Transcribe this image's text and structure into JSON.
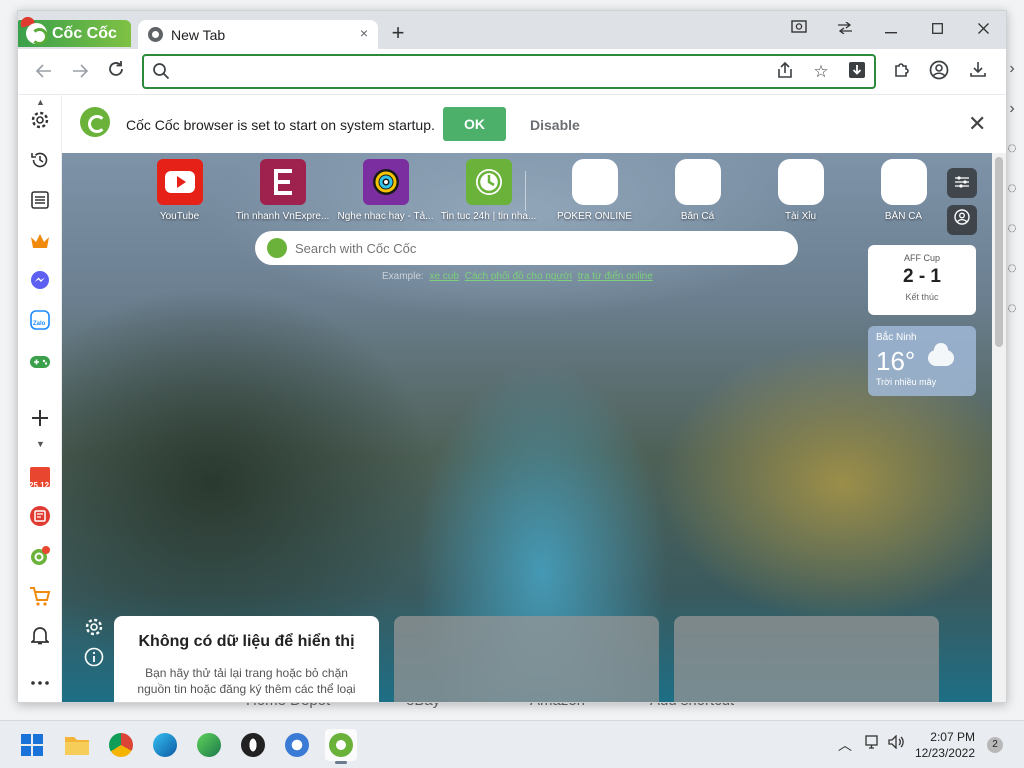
{
  "window": {
    "brand_name": "Cốc Cốc",
    "tab_title": "New Tab",
    "new_tab_symbol": "+",
    "tab_close_symbol": "×"
  },
  "omnibox": {
    "value": "",
    "placeholder": ""
  },
  "notification": {
    "message": "Cốc Cốc browser is set to start on system startup.",
    "ok_label": "OK",
    "disable_label": "Disable",
    "close_symbol": "✕"
  },
  "sidebar": {
    "items": [
      "settings-icon",
      "history-icon",
      "reading-list-icon",
      "crown-icon",
      "messenger-icon",
      "zalo-icon",
      "games-icon",
      "add-icon",
      "calendar-icon",
      "news-icon",
      "coccoc-icon",
      "shopping-icon",
      "bell-icon",
      "more-icon"
    ],
    "calendar_label": "25.12",
    "zalo_label": "Zalo"
  },
  "shortcuts": [
    {
      "label": "YouTube",
      "icon": "youtube-icon",
      "color": "#e62117"
    },
    {
      "label": "Tin nhanh VnExpre...",
      "icon": "vnexpress-icon",
      "color": "#9f224e"
    },
    {
      "label": "Nghe nhac hay - Tả...",
      "icon": "music-icon",
      "color": "#7b2ea0"
    },
    {
      "label": "Tin tuc 24h | tin nha...",
      "icon": "news24-icon",
      "color": "#6ab23a"
    },
    {
      "label": "POKER ONLINE",
      "icon": "broken-image-icon",
      "color": "#ffffff"
    },
    {
      "label": "Bắn Cá",
      "icon": "broken-image-icon",
      "color": "#ffffff"
    },
    {
      "label": "Tài Xỉu",
      "icon": "broken-image-icon",
      "color": "#ffffff"
    },
    {
      "label": "BẮN CÁ",
      "icon": "broken-image-icon",
      "color": "#ffffff"
    }
  ],
  "ntp_search": {
    "placeholder": "Search with Cốc Cốc",
    "example_prefix": "Example:",
    "example_links": [
      "xe cub",
      "Cách phối đồ cho người",
      "tra từ điển online"
    ]
  },
  "score": {
    "title": "AFF Cup",
    "value": "2 - 1",
    "status": "Kết thúc"
  },
  "weather": {
    "city": "Bắc Ninh",
    "temperature": "16°",
    "description": "Trời nhiều mây"
  },
  "news_card": {
    "title": "Không có dữ liệu để hiển thị",
    "body": "Bạn hãy thử tải lại trang hoặc bỏ chặn nguồn tin hoặc đăng ký thêm các thể loại"
  },
  "behind_labels": [
    "Home Depot",
    "eBay",
    "Amazon",
    "Add shortcut"
  ],
  "taskbar": {
    "time": "2:07 PM",
    "date": "12/23/2022",
    "notification_count": "2"
  }
}
